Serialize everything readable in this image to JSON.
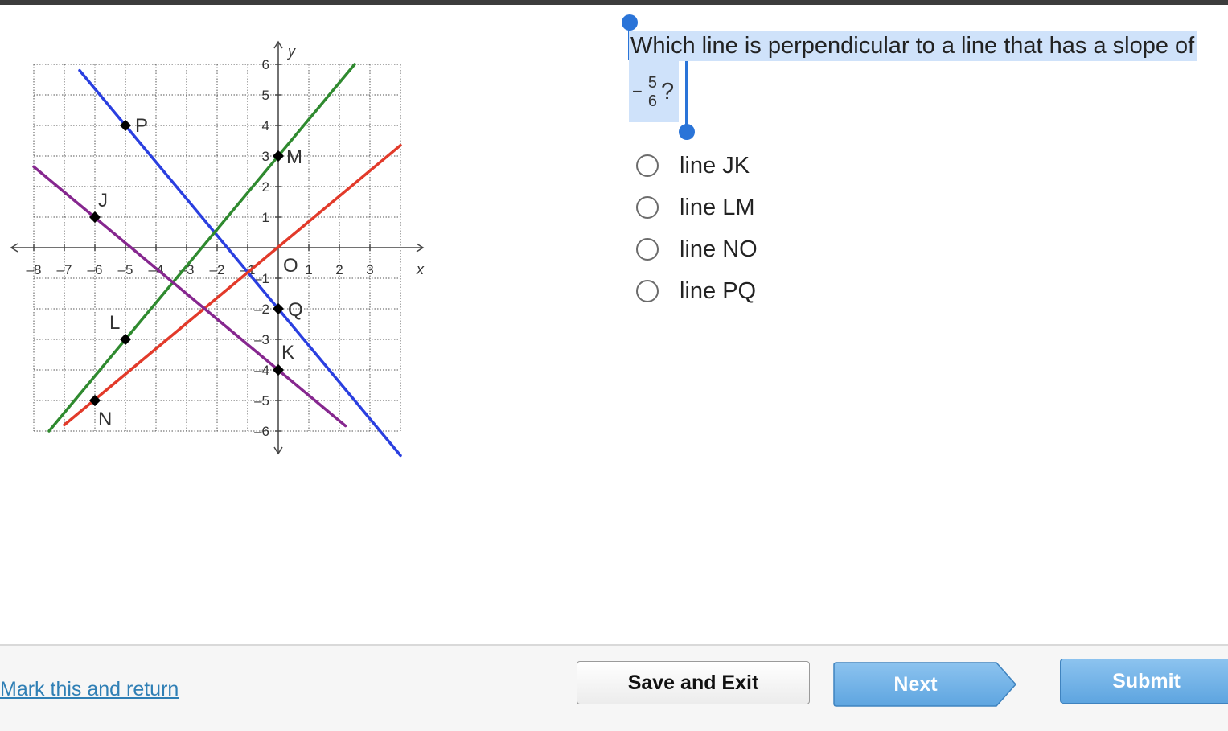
{
  "question": {
    "text_line1": "Which line is perpendicular to a line that has a slope of",
    "minus": "−",
    "numerator": "5",
    "denominator": "6",
    "question_mark": "?"
  },
  "options": [
    {
      "label": "line JK"
    },
    {
      "label": "line LM"
    },
    {
      "label": "line NO"
    },
    {
      "label": "line PQ"
    }
  ],
  "footer": {
    "mark_label": "Mark this and return",
    "save_label": "Save and Exit",
    "next_label": "Next",
    "submit_label": "Submit"
  },
  "chart_data": {
    "type": "line",
    "xlabel": "x",
    "ylabel": "y",
    "xlim": [
      -8,
      4
    ],
    "ylim": [
      -6,
      6
    ],
    "grid": true,
    "x_ticks": [
      {
        "v": -8,
        "t": "–8"
      },
      {
        "v": -7,
        "t": "–7"
      },
      {
        "v": -6,
        "t": "–6"
      },
      {
        "v": -5,
        "t": "–5"
      },
      {
        "v": -4,
        "t": "–4"
      },
      {
        "v": -3,
        "t": "–3"
      },
      {
        "v": -2,
        "t": "–2"
      },
      {
        "v": -1,
        "t": "–1"
      },
      {
        "v": 1,
        "t": "1"
      },
      {
        "v": 2,
        "t": "2"
      },
      {
        "v": 3,
        "t": "3"
      }
    ],
    "y_ticks": [
      {
        "v": 6,
        "t": "6"
      },
      {
        "v": 5,
        "t": "5"
      },
      {
        "v": 4,
        "t": "4"
      },
      {
        "v": 3,
        "t": "3"
      },
      {
        "v": 2,
        "t": "2"
      },
      {
        "v": 1,
        "t": "1"
      },
      {
        "v": -1,
        "t": "–1"
      },
      {
        "v": -2,
        "t": "–2"
      },
      {
        "v": -3,
        "t": "–3"
      },
      {
        "v": -4,
        "t": "–4"
      },
      {
        "v": -5,
        "t": "–5"
      },
      {
        "v": -6,
        "t": "–6"
      }
    ],
    "lines": [
      {
        "color": "#2a3fe0",
        "x1": -6.5,
        "y1": 5.8,
        "x2": 4,
        "y2": -6.8
      },
      {
        "color": "#2f8a2f",
        "x1": -7.5,
        "y1": -6,
        "x2": 2.5,
        "y2": 6
      },
      {
        "color": "#e23a2a",
        "x1": -7,
        "y1": -5.8,
        "x2": 4,
        "y2": 3.35
      },
      {
        "color": "#86278f",
        "x1": -8,
        "y1": 2.65,
        "x2": 2.2,
        "y2": -5.83
      }
    ],
    "points": [
      {
        "label": "P",
        "x": -5,
        "y": 4
      },
      {
        "label": "Q",
        "x": 0,
        "y": -2
      },
      {
        "label": "M",
        "x": 0,
        "y": 3
      },
      {
        "label": "L",
        "x": -5,
        "y": -3
      },
      {
        "label": "J",
        "x": -6,
        "y": 1
      },
      {
        "label": "K",
        "x": 0,
        "y": -4
      },
      {
        "label": "N",
        "x": -6,
        "y": -5
      },
      {
        "label": "O",
        "x": 0,
        "y": 0
      }
    ],
    "colors": {
      "grid": "#555555",
      "axis": "#444444"
    }
  }
}
